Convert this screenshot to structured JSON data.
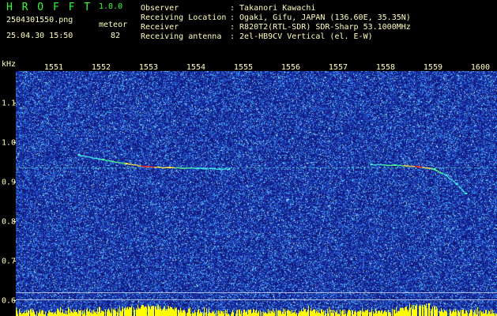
{
  "header": {
    "app_name": "H R O F F T",
    "version": "1.0.0",
    "filename": "2504301550.png",
    "datetime": "25.04.30 15:50",
    "mode_label": "meteor",
    "meteor_count": "82",
    "info": [
      {
        "label": "Observer",
        "value": ": Takanori Kawachi"
      },
      {
        "label": "Receiving Location",
        "value": ": Ogaki, Gifu, JAPAN (136.60E, 35.35N)"
      },
      {
        "label": "Receiver",
        "value": ": R820T2(RTL-SDR) SDR-Sharp 53.1000MHz"
      },
      {
        "label": "Receiving antenna",
        "value": ": 2el-HB9CV Vertical (el. E-W)"
      }
    ]
  },
  "colors": {
    "title": "#33ff33",
    "text": "#ffffc0",
    "background": "#000000",
    "carrier": "#3fb6d6",
    "level_trace": "#ffff00",
    "reference_line": "#d0d8ff"
  },
  "chart_data": {
    "type": "heatmap",
    "ylabel": "kHz",
    "x_ticks": [
      "1551",
      "1552",
      "1553",
      "1554",
      "1555",
      "1556",
      "1557",
      "1558",
      "1559",
      "1600"
    ],
    "y_ticks": [
      "1.1",
      "1.0",
      "0.9",
      "0.8",
      "0.7",
      "0.6"
    ],
    "xlim": [
      "15:50:00",
      "16:00:09"
    ],
    "ylim": [
      0.56,
      1.18
    ],
    "grid": false,
    "carrier": {
      "frequency_khz": 0.936
    },
    "echoes": [
      {
        "points": [
          {
            "t": "15:51:20",
            "f": 0.968,
            "level": 0.5
          },
          {
            "t": "15:51:50",
            "f": 0.956,
            "level": 0.55
          },
          {
            "t": "15:52:20",
            "f": 0.946,
            "level": 0.7
          },
          {
            "t": "15:52:45",
            "f": 0.938,
            "level": 0.9
          },
          {
            "t": "15:53:15",
            "f": 0.936,
            "level": 0.75
          },
          {
            "t": "15:53:50",
            "f": 0.934,
            "level": 0.5
          },
          {
            "t": "15:54:30",
            "f": 0.932,
            "level": 0.4
          }
        ]
      },
      {
        "points": [
          {
            "t": "15:57:30",
            "f": 0.944,
            "level": 0.5
          },
          {
            "t": "15:58:00",
            "f": 0.942,
            "level": 0.6
          },
          {
            "t": "15:58:30",
            "f": 0.938,
            "level": 0.9
          },
          {
            "t": "15:58:50",
            "f": 0.932,
            "level": 0.65
          },
          {
            "t": "15:59:05",
            "f": 0.916,
            "level": 0.5
          },
          {
            "t": "15:59:18",
            "f": 0.894,
            "level": 0.45
          },
          {
            "t": "15:59:30",
            "f": 0.87,
            "level": 0.4
          }
        ]
      }
    ]
  }
}
